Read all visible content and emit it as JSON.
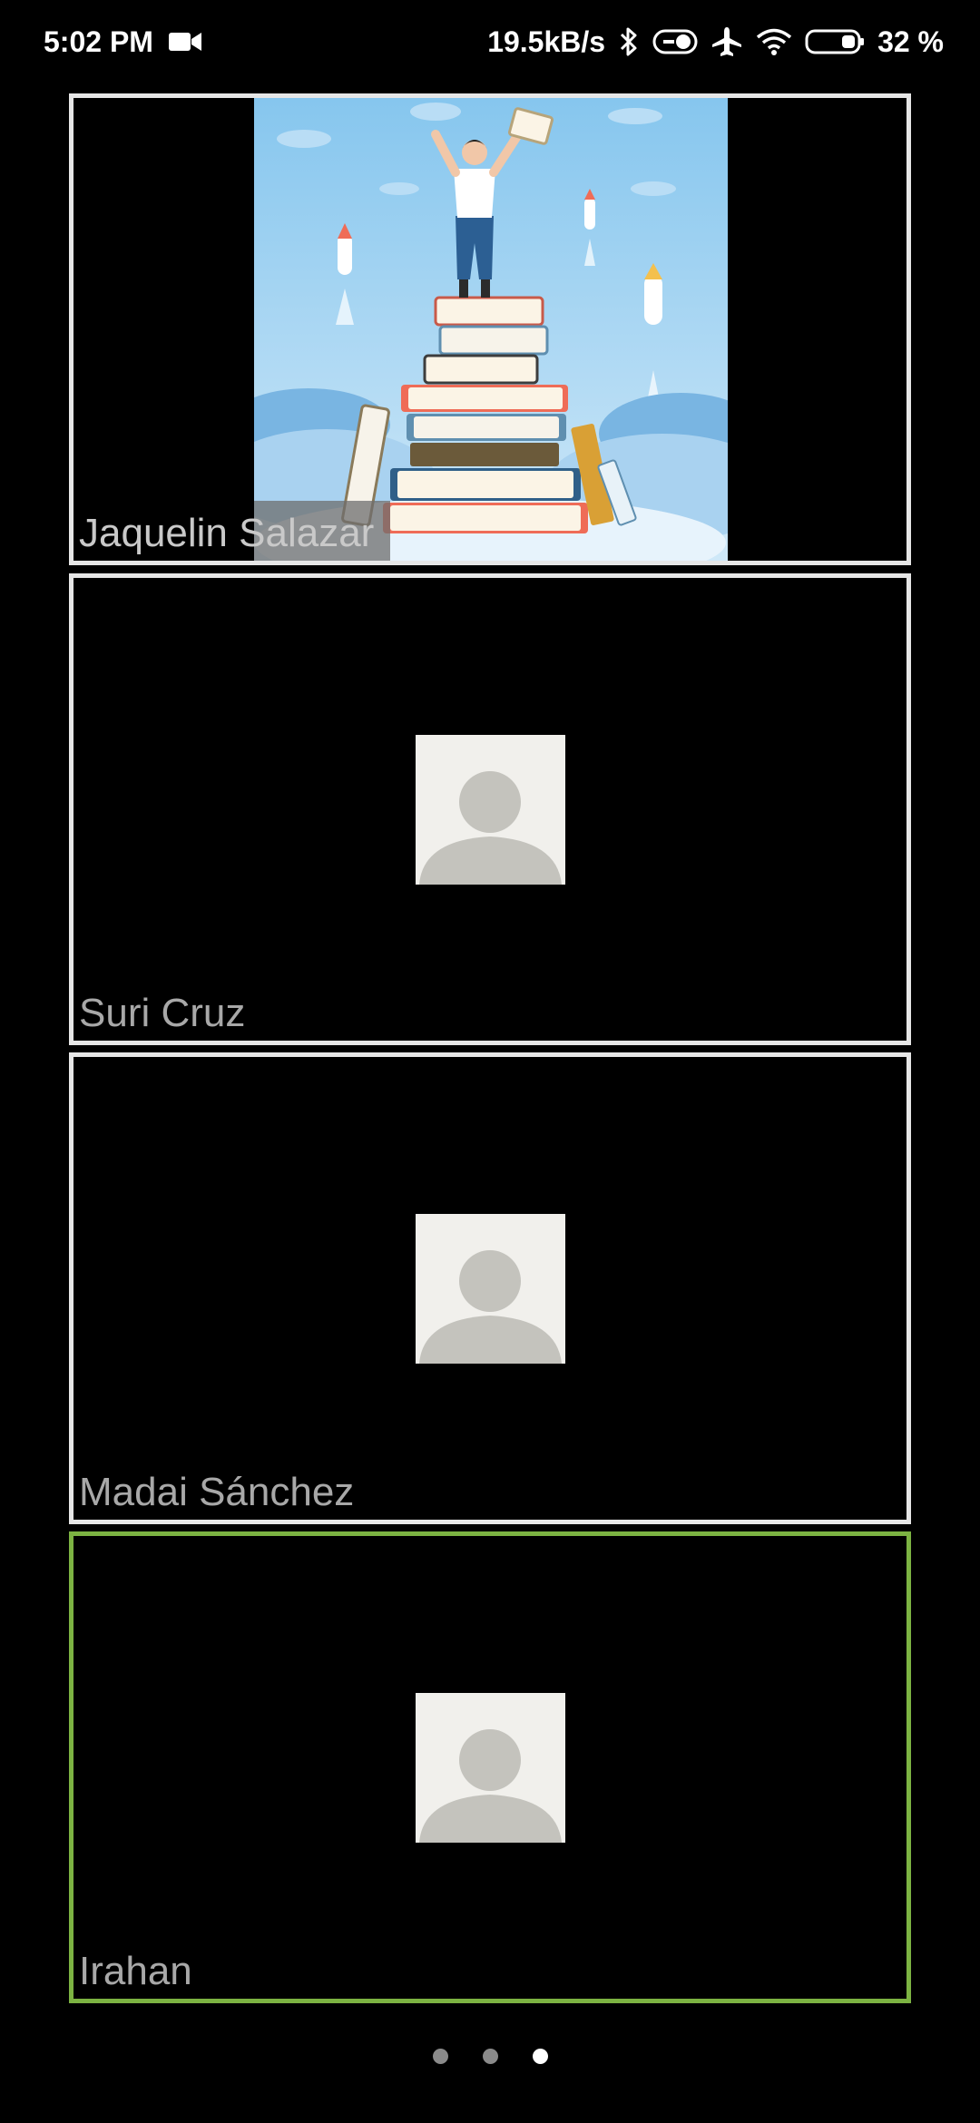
{
  "status_bar": {
    "time": "5:02 PM",
    "net_speed": "19.5kB/s",
    "battery_percent": "32 %",
    "icons": [
      "video-camera-icon",
      "bluetooth-icon",
      "toggle-icon",
      "airplane-icon",
      "wifi-icon",
      "battery-icon"
    ]
  },
  "participants": [
    {
      "name": "Jaquelin Salazar",
      "has_video": true,
      "active": false
    },
    {
      "name": "Suri Cruz",
      "has_video": false,
      "active": false
    },
    {
      "name": "Madai Sánchez",
      "has_video": false,
      "active": false
    },
    {
      "name": "Irahan",
      "has_video": false,
      "active": true
    }
  ],
  "pagination": {
    "total_pages": 3,
    "current_page": 3
  },
  "colors": {
    "active_border": "#7cb342",
    "tile_border": "#e6e6e6",
    "name_text": "#a8a8a8",
    "avatar_bg": "#f1f0ec",
    "avatar_silhouette": "#c4c3bd"
  }
}
